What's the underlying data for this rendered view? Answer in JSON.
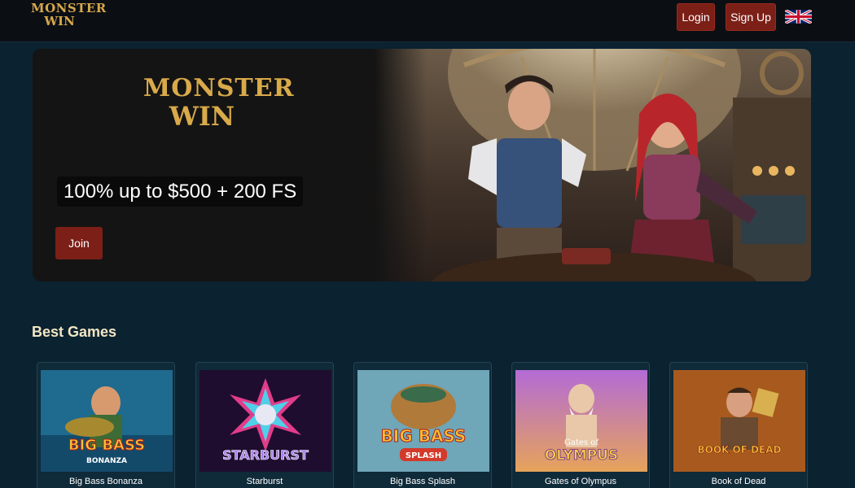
{
  "header": {
    "logo_line1": "MONSTER",
    "logo_line2": "WIN",
    "login_label": "Login",
    "signup_label": "Sign Up",
    "language_flag": "uk-flag-icon"
  },
  "hero": {
    "logo_line1": "MONSTER",
    "logo_line2": "WIN",
    "offer_text": "100% up to $500 + 200 FS",
    "join_label": "Join"
  },
  "games_section": {
    "title": "Best Games",
    "games": [
      {
        "name": "Big Bass Bonanza",
        "thumb_title_1": "BIG BASS",
        "thumb_title_2": "BONANZA"
      },
      {
        "name": "Starburst",
        "thumb_title_1": "STARBURST",
        "thumb_title_2": ""
      },
      {
        "name": "Big Bass Splash",
        "thumb_title_1": "BIG BASS",
        "thumb_title_2": "SPLASH"
      },
      {
        "name": "Gates of Olympus",
        "thumb_title_1": "Gates of",
        "thumb_title_2": "OLYMPUS"
      },
      {
        "name": "Book of Dead",
        "thumb_title_1": "BOOK OF DEAD",
        "thumb_title_2": ""
      }
    ]
  },
  "colors": {
    "page_bg": "#0b2230",
    "header_bg": "#0b0f14",
    "button_red": "#7b1f17",
    "gold": "#d9aa4a"
  }
}
